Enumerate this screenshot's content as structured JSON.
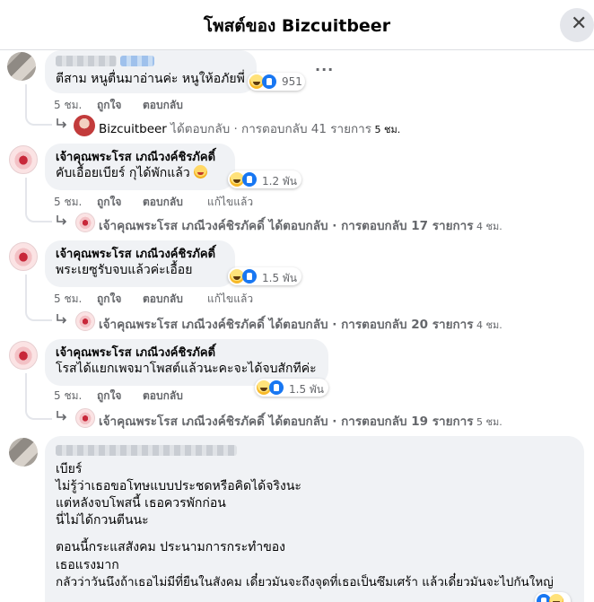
{
  "header": {
    "title": "โพสต์ของ Bizcuitbeer",
    "close_glyph": "✕"
  },
  "comments": [
    {
      "author": "",
      "text": "ตีสาม หนูตื่นมาอ่านค่ะ หนูให้อภัยพี่",
      "reaction_count": "951",
      "actions": {
        "time": "5 ชม.",
        "like": "ถูกใจ",
        "reply": "ตอบกลับ",
        "edit": ""
      },
      "reply_summary": {
        "name": "Bizcuitbeer",
        "text": " ได้ตอบกลับ · การตอบกลับ 41 รายการ",
        "time": " 5 ชม."
      }
    },
    {
      "author": "เจ้าคุณพระโรส เภณีวงค์ชิรภัคดิ์",
      "text": "คับเอื้อยเบียร์ กุได้พักแล้ว",
      "reaction_count": "1.2 พัน",
      "actions": {
        "time": "5 ชม.",
        "like": "ถูกใจ",
        "reply": "ตอบกลับ",
        "edit": "แก้ไขแล้ว"
      },
      "reply_summary": {
        "name": "เจ้าคุณพระโรส เภณีวงค์ชิรภัคดิ์",
        "text": " ได้ตอบกลับ · การตอบกลับ 17 รายการ",
        "time": " 4 ชม."
      }
    },
    {
      "author": "เจ้าคุณพระโรส เภณีวงค์ชิรภัคดิ์",
      "text": "พระเยซูรับจบแล้วค่ะเอื้อย",
      "reaction_count": "1.5 พัน",
      "actions": {
        "time": "5 ชม.",
        "like": "ถูกใจ",
        "reply": "ตอบกลับ",
        "edit": "แก้ไขแล้ว"
      },
      "reply_summary": {
        "name": "เจ้าคุณพระโรส เภณีวงค์ชิรภัคดิ์",
        "text": " ได้ตอบกลับ · การตอบกลับ 20 รายการ",
        "time": " 4 ชม."
      }
    },
    {
      "author": "เจ้าคุณพระโรส เภณีวงค์ชิรภัคดิ์",
      "text": "โรสได้แยกเพจมาโพสต์แล้วนะคะจะได้จบสักทีค่ะ",
      "reaction_count": "1.5 พัน",
      "actions": {
        "time": "5 ชม.",
        "like": "ถูกใจ",
        "reply": "ตอบกลับ",
        "edit": ""
      },
      "reply_summary": {
        "name": "เจ้าคุณพระโรส เภณีวงค์ชิรภัคดิ์",
        "text": " ได้ตอบกลับ · การตอบกลับ 19 รายการ",
        "time": " 5 ชม."
      }
    }
  ],
  "long_comment": {
    "lines": [
      "เบียร์",
      "ไม่รู้ว่าเธอขอโทษแบบประชดหรือคิดได้จริงนะ",
      "แต่หลังจบโพสนี้ เธอควรพักก่อน",
      "นี่ไม่ได้กวนตีนนะ",
      "ตอนนี้กระแสสังคม ประนามการกระทำของ",
      "เธอแรงมาก",
      "กลัวว่าวันนึงถ้าเธอไม่มีที่ยืนในสังคม เดี๋ยวมันจะถึงจุดที่เธอเป็นซึมเศร้า แล้วเดี๋ยวมันจะไปกันใหญ่"
    ]
  },
  "more_glyph": "···"
}
